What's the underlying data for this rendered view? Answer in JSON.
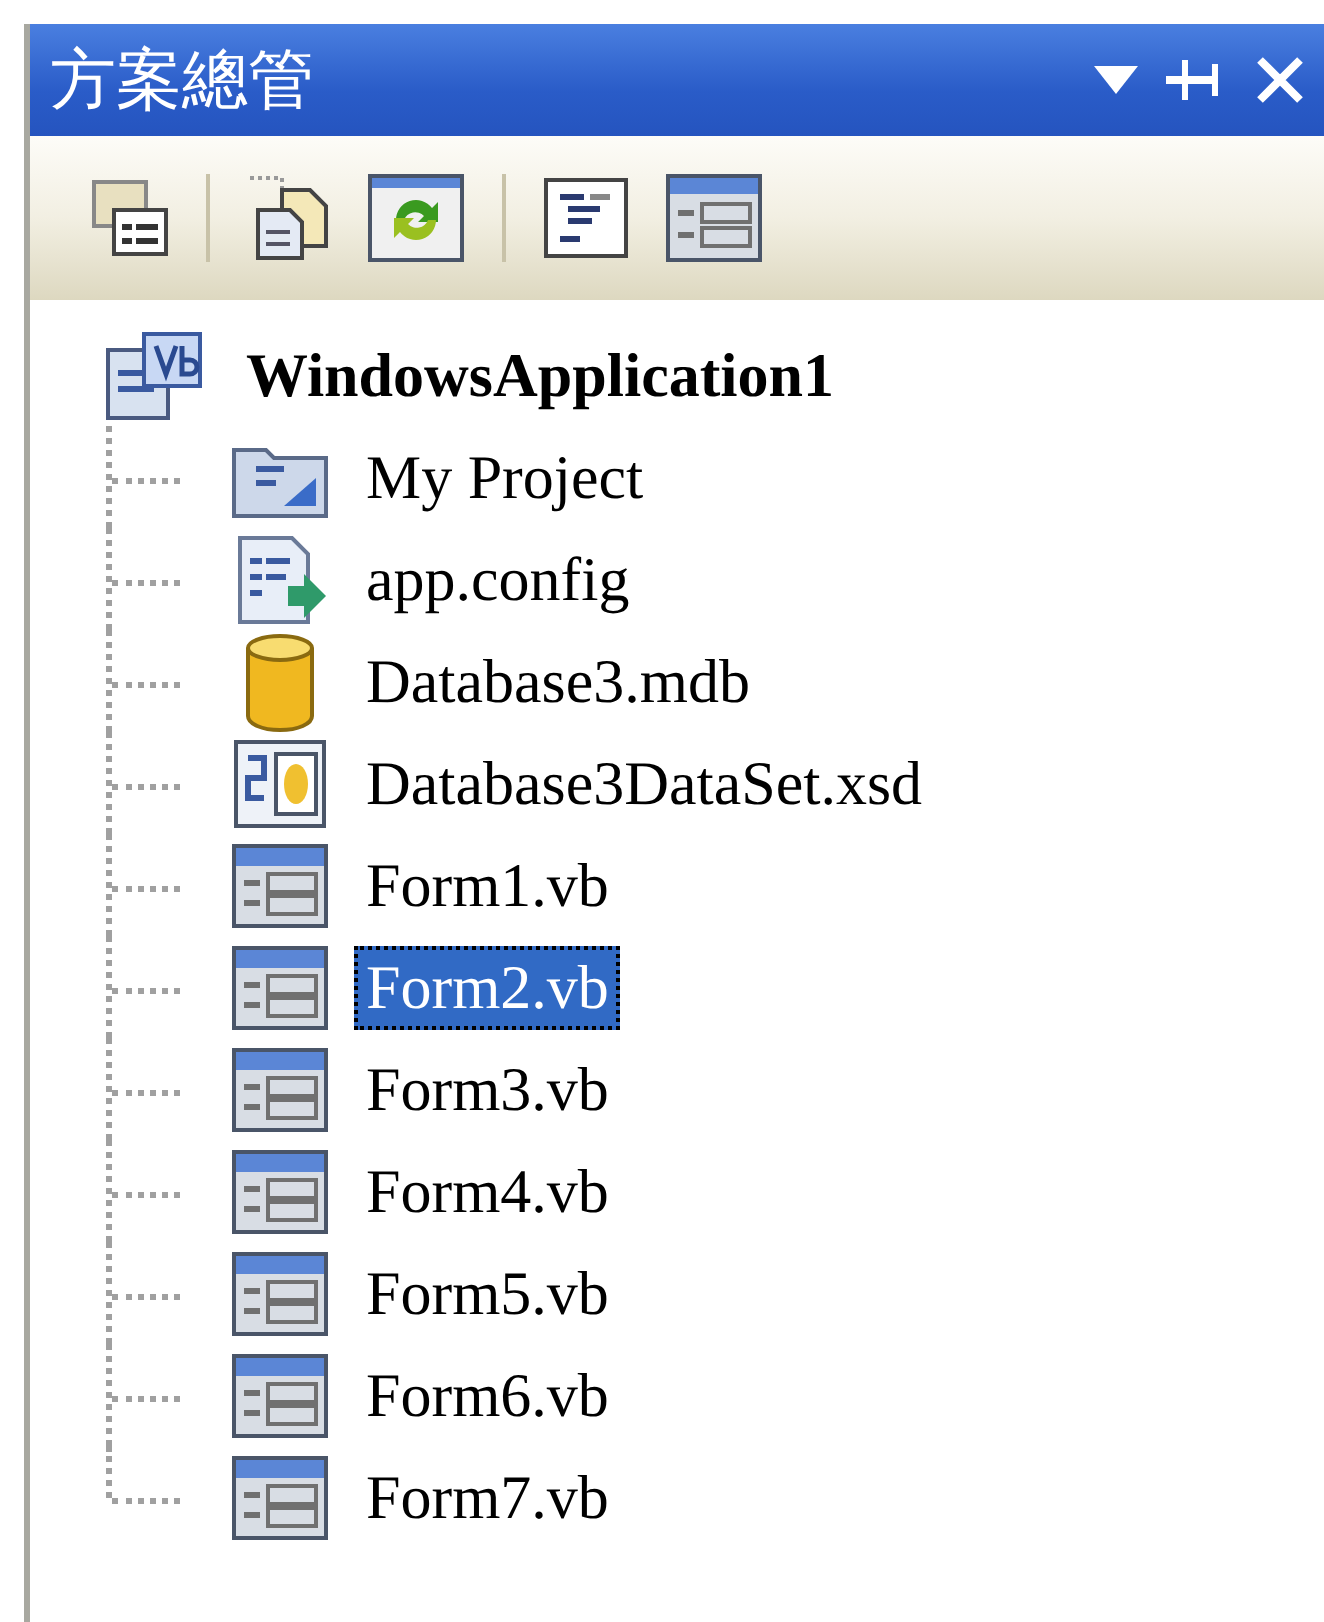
{
  "window": {
    "title": "方案總管"
  },
  "tree": {
    "label": "WindowsApplication1",
    "kind": "project",
    "selected": false,
    "children": [
      {
        "label": "My Project",
        "kind": "properties",
        "selected": false
      },
      {
        "label": "app.config",
        "kind": "config",
        "selected": false
      },
      {
        "label": "Database3.mdb",
        "kind": "database",
        "selected": false
      },
      {
        "label": "Database3DataSet.xsd",
        "kind": "dataset",
        "selected": false
      },
      {
        "label": "Form1.vb",
        "kind": "form",
        "selected": false
      },
      {
        "label": "Form2.vb",
        "kind": "form",
        "selected": true
      },
      {
        "label": "Form3.vb",
        "kind": "form",
        "selected": false
      },
      {
        "label": "Form4.vb",
        "kind": "form",
        "selected": false
      },
      {
        "label": "Form5.vb",
        "kind": "form",
        "selected": false
      },
      {
        "label": "Form6.vb",
        "kind": "form",
        "selected": false
      },
      {
        "label": "Form7.vb",
        "kind": "form",
        "selected": false
      }
    ]
  }
}
